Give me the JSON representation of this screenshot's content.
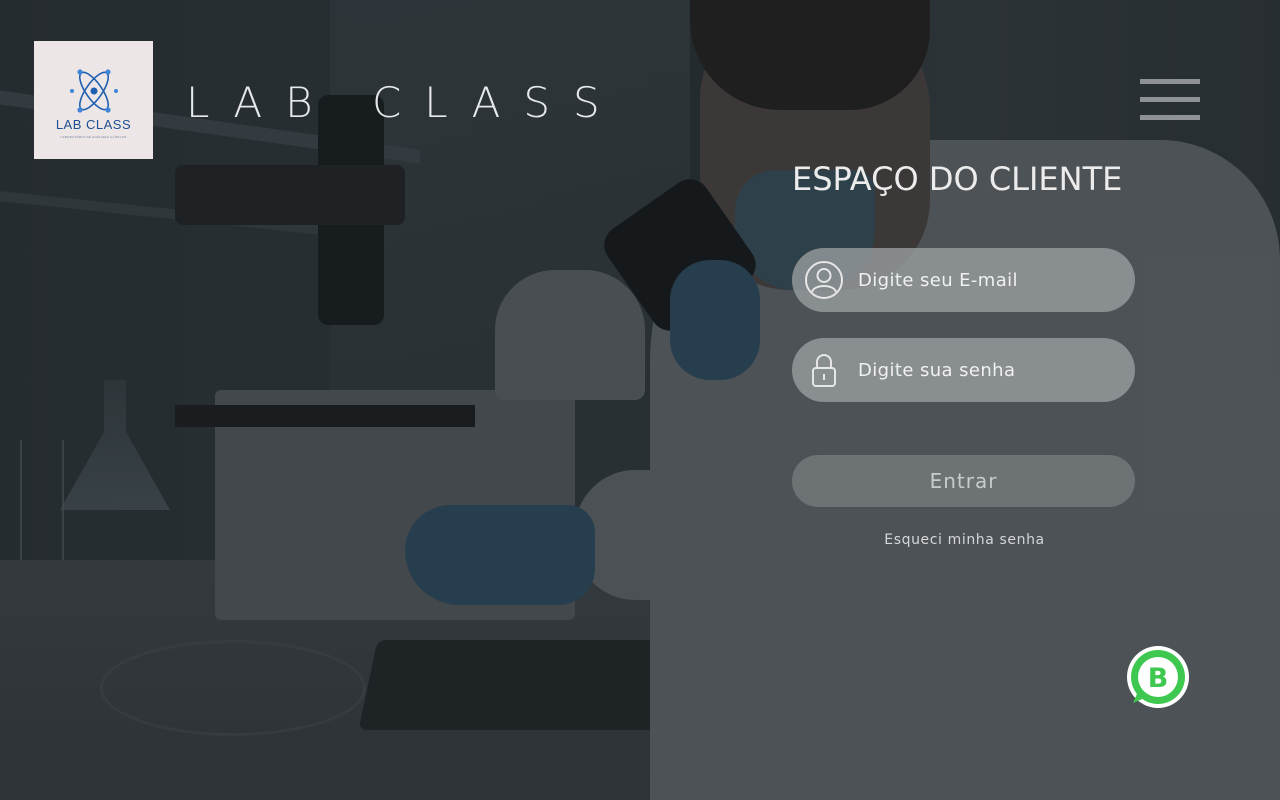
{
  "header": {
    "logo": {
      "name": "LAB CLASS",
      "tagline": "LABORATÓRIO DE ANÁLISES CLÍNICAS",
      "icon": "atom-icon",
      "color": "#1f4f93"
    },
    "brand_title": "LAB CLASS",
    "menu_icon": "hamburger-menu-icon"
  },
  "login": {
    "title": "ESPAÇO DO CLIENTE",
    "email": {
      "placeholder": "Digite seu E-mail",
      "value": "",
      "icon": "user-icon"
    },
    "password": {
      "placeholder": "Digite sua senha",
      "value": "",
      "icon": "lock-icon"
    },
    "submit_label": "Entrar",
    "forgot_label": "Esqueci minha senha"
  },
  "floating": {
    "whatsapp_icon": "whatsapp-business-icon",
    "whatsapp_color": "#3fc850"
  }
}
